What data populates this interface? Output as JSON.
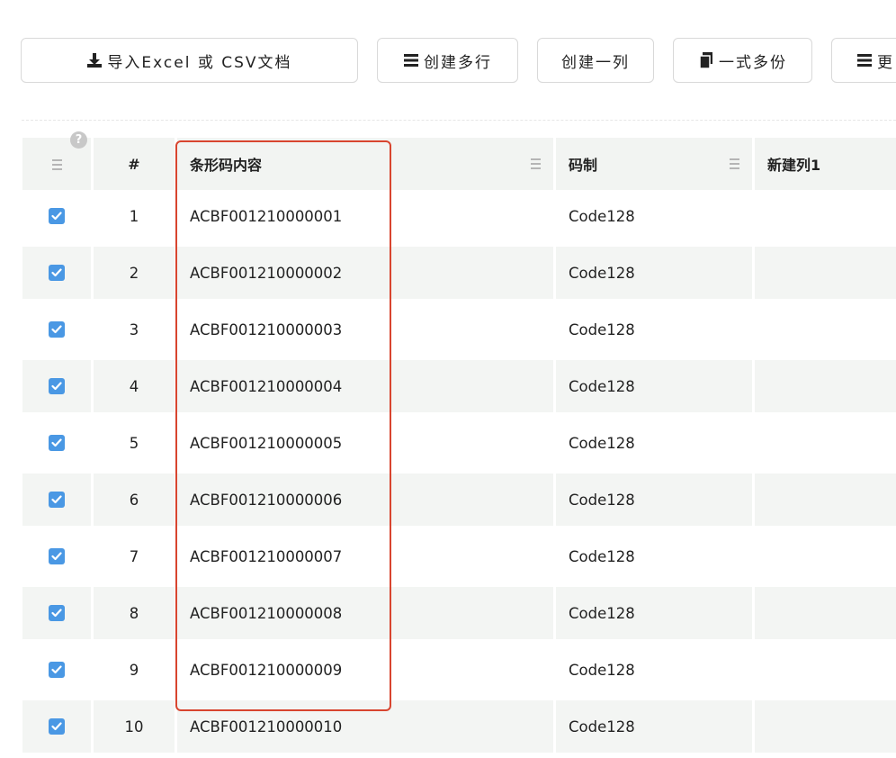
{
  "toolbar": {
    "import_label": "导入Excel 或 CSV文档",
    "create_rows_label": "创建多行",
    "create_column_label": "创建一列",
    "duplicate_label": "一式多份",
    "more_label": "更"
  },
  "table": {
    "headers": {
      "select": "",
      "index": "#",
      "content": "条形码内容",
      "symbology": "码制",
      "new_column": "新建列1"
    },
    "help_icon": "?",
    "rows": [
      {
        "checked": true,
        "index": "1",
        "content": "ACBF001210000001",
        "symbology": "Code128",
        "new_column": ""
      },
      {
        "checked": true,
        "index": "2",
        "content": "ACBF001210000002",
        "symbology": "Code128",
        "new_column": ""
      },
      {
        "checked": true,
        "index": "3",
        "content": "ACBF001210000003",
        "symbology": "Code128",
        "new_column": ""
      },
      {
        "checked": true,
        "index": "4",
        "content": "ACBF001210000004",
        "symbology": "Code128",
        "new_column": ""
      },
      {
        "checked": true,
        "index": "5",
        "content": "ACBF001210000005",
        "symbology": "Code128",
        "new_column": ""
      },
      {
        "checked": true,
        "index": "6",
        "content": "ACBF001210000006",
        "symbology": "Code128",
        "new_column": ""
      },
      {
        "checked": true,
        "index": "7",
        "content": "ACBF001210000007",
        "symbology": "Code128",
        "new_column": ""
      },
      {
        "checked": true,
        "index": "8",
        "content": "ACBF001210000008",
        "symbology": "Code128",
        "new_column": ""
      },
      {
        "checked": true,
        "index": "9",
        "content": "ACBF001210000009",
        "symbology": "Code128",
        "new_column": ""
      },
      {
        "checked": true,
        "index": "10",
        "content": "ACBF001210000010",
        "symbology": "Code128",
        "new_column": ""
      }
    ]
  },
  "colors": {
    "accent_checkbox": "#4a98e4",
    "highlight_frame": "#d8452f",
    "row_alt_background": "#f3f5f3"
  }
}
